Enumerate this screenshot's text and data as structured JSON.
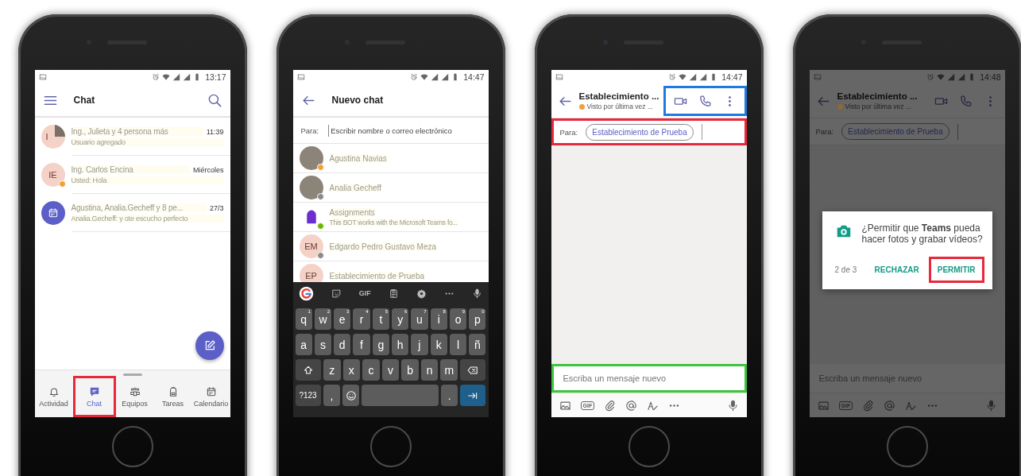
{
  "phones": [
    {
      "kind": "chat_list",
      "status": {
        "time": "13:17"
      },
      "title": "Chat",
      "chats": [
        {
          "name": "Ing., Julieta y 4 persona más",
          "preview": "Usuario agregado",
          "time": "11:39",
          "avatar": {
            "kind": "split",
            "initials": "I"
          }
        },
        {
          "name": "Ing. Carlos Encina",
          "preview": "Usted: Hola",
          "time": "Miércoles",
          "avatar": {
            "kind": "initials",
            "initials": "IE"
          },
          "color": "#f0a23a"
        },
        {
          "name": "Agustina, Analia.Gecheff y 8 pe...",
          "preview": "Analia.Gecheff: y ote escucho perfecto",
          "time": "27/3",
          "avatar": {
            "kind": "calendar"
          }
        }
      ],
      "nav": [
        {
          "kind": "activity",
          "label": "Actividad",
          "selected": false
        },
        {
          "kind": "chat",
          "label": "Chat",
          "selected": true,
          "color": "#e8283c"
        },
        {
          "kind": "teams",
          "label": "Equipos",
          "selected": false
        },
        {
          "kind": "assignments",
          "label": "Tareas",
          "selected": false
        },
        {
          "kind": "calendar",
          "label": "Calendario",
          "selected": false
        }
      ]
    },
    {
      "kind": "new_chat",
      "status": {
        "time": "14:47"
      },
      "title": "Nuevo chat",
      "to": {
        "label": "Para:",
        "placeholder": "Escribir nombre o correo electrónico"
      },
      "contacts": [
        {
          "name": "Agustina Navias",
          "avatar": {
            "kind": "photo"
          },
          "color": "#f0a23a"
        },
        {
          "name": "Analia Gecheff",
          "avatar": {
            "kind": "photo"
          },
          "color": "#8a8a8a"
        },
        {
          "name": "Assignments",
          "preview": "This BOT works with the Microsoft Teams fo...",
          "avatar": {
            "kind": "bot"
          },
          "color": "#6bb700"
        },
        {
          "name": "Edgardo Pedro Gustavo Meza",
          "avatar": {
            "kind": "initials",
            "initials": "EM"
          },
          "color": "#8a8a8a"
        },
        {
          "name": "Establecimiento de Prueba",
          "avatar": {
            "kind": "initials",
            "initials": "EP"
          }
        }
      ],
      "keyboard": {
        "toolbar": [
          {
            "kind": "google"
          },
          {
            "kind": "sticker"
          },
          {
            "kind": "gif",
            "label": "GIF"
          },
          {
            "kind": "clipboard"
          },
          {
            "kind": "settings"
          },
          {
            "kind": "more"
          },
          {
            "kind": "mic"
          }
        ],
        "rows": [
          [
            {
              "kind": "letter",
              "label": "q",
              "hint": "1"
            },
            {
              "kind": "letter",
              "label": "w",
              "hint": "2"
            },
            {
              "kind": "letter",
              "label": "e",
              "hint": "3"
            },
            {
              "kind": "letter",
              "label": "r",
              "hint": "4"
            },
            {
              "kind": "letter",
              "label": "t",
              "hint": "5"
            },
            {
              "kind": "letter",
              "label": "y",
              "hint": "6"
            },
            {
              "kind": "letter",
              "label": "u",
              "hint": "7"
            },
            {
              "kind": "letter",
              "label": "i",
              "hint": "8"
            },
            {
              "kind": "letter",
              "label": "o",
              "hint": "9"
            },
            {
              "kind": "letter",
              "label": "p",
              "hint": "0"
            }
          ],
          [
            {
              "kind": "letter",
              "label": "a"
            },
            {
              "kind": "letter",
              "label": "s"
            },
            {
              "kind": "letter",
              "label": "d"
            },
            {
              "kind": "letter",
              "label": "f"
            },
            {
              "kind": "letter",
              "label": "g"
            },
            {
              "kind": "letter",
              "label": "h"
            },
            {
              "kind": "letter",
              "label": "j"
            },
            {
              "kind": "letter",
              "label": "k"
            },
            {
              "kind": "letter",
              "label": "l"
            },
            {
              "kind": "letter",
              "label": "ñ"
            }
          ],
          [
            {
              "kind": "shift"
            },
            {
              "kind": "letter",
              "label": "z"
            },
            {
              "kind": "letter",
              "label": "x"
            },
            {
              "kind": "letter",
              "label": "c"
            },
            {
              "kind": "letter",
              "label": "v"
            },
            {
              "kind": "letter",
              "label": "b"
            },
            {
              "kind": "letter",
              "label": "n"
            },
            {
              "kind": "letter",
              "label": "m"
            },
            {
              "kind": "backspace"
            }
          ],
          [
            {
              "kind": "mode",
              "label": "?123"
            },
            {
              "kind": "text",
              "label": ","
            },
            {
              "kind": "emoji"
            },
            {
              "kind": "space"
            },
            {
              "kind": "text",
              "label": "."
            },
            {
              "kind": "enter"
            }
          ]
        ]
      }
    },
    {
      "kind": "conversation",
      "status": {
        "time": "14:47"
      },
      "title": "Establecimiento ...",
      "subtitle": "Visto por última vez ...",
      "color": "#f0a23a",
      "actions": {
        "color": "#1f7ae0"
      },
      "to": {
        "label": "Para:",
        "recipient": "Establecimiento de Prueba",
        "color": "#e8283c"
      },
      "composer": {
        "placeholder": "Escriba un mensaje nuevo",
        "color": "#3ec43e"
      },
      "tools": [
        {
          "kind": "image"
        },
        {
          "kind": "gif",
          "label": "GIF"
        },
        {
          "kind": "attach"
        },
        {
          "kind": "mention"
        },
        {
          "kind": "format"
        },
        {
          "kind": "more"
        },
        {
          "kind": "mic"
        }
      ],
      "dimmed": false
    },
    {
      "kind": "conversation",
      "status": {
        "time": "14:48"
      },
      "title": "Establecimiento ...",
      "subtitle": "Visto por última vez ...",
      "color": "#8c6a35",
      "to": {
        "label": "Para:",
        "recipient": "Establecimiento de Prueba"
      },
      "composer": {
        "placeholder": "Escriba un mensaje nuevo"
      },
      "tools": [
        {
          "kind": "image"
        },
        {
          "kind": "gif",
          "label": "GIF"
        },
        {
          "kind": "attach"
        },
        {
          "kind": "mention"
        },
        {
          "kind": "format"
        },
        {
          "kind": "more"
        },
        {
          "kind": "mic"
        }
      ],
      "dimmed": true,
      "dialog": {
        "message": "¿Permitir que **Teams** pueda hacer fotos y grabar vídeos?",
        "counter": "2 de 3",
        "buttons": [
          {
            "label": "RECHAZAR"
          },
          {
            "label": "PERMITIR",
            "color": "#e8283c"
          }
        ]
      }
    }
  ]
}
